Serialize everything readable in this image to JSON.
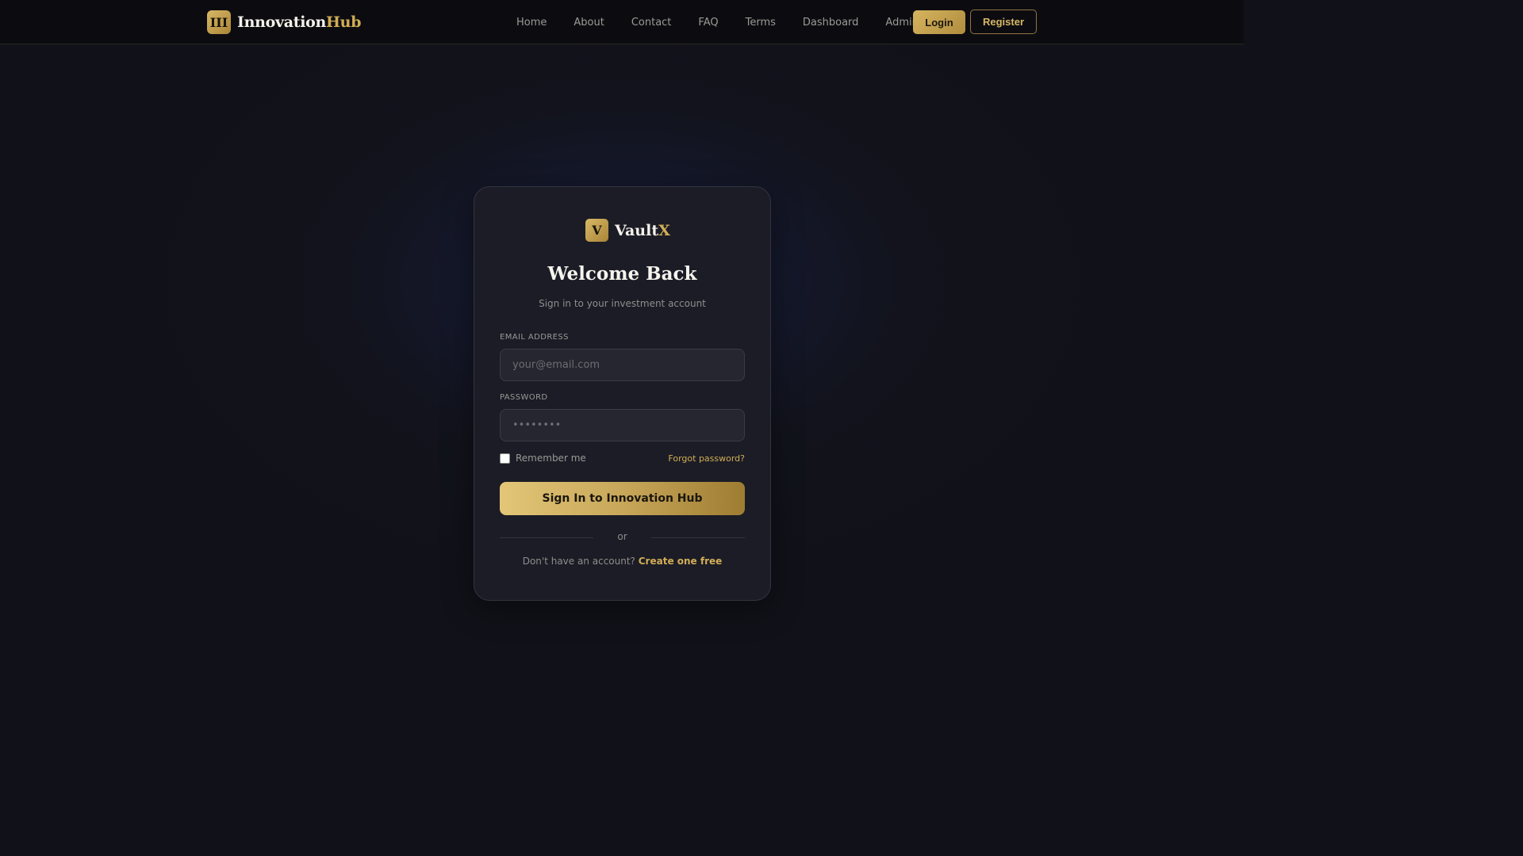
{
  "navbar": {
    "brand_badge": "III",
    "brand_main": "Innovation",
    "brand_accent": "Hub",
    "links": [
      "Home",
      "About",
      "Contact",
      "FAQ",
      "Terms",
      "Dashboard",
      "Admin"
    ],
    "login_label": "Login",
    "register_label": "Register"
  },
  "card": {
    "logo_badge": "V",
    "logo_main": "Vault",
    "logo_accent": "X",
    "title": "Welcome Back",
    "subtitle": "Sign in to your investment account",
    "email_label": "EMAIL ADDRESS",
    "email_placeholder": "your@email.com",
    "email_value": "",
    "password_label": "PASSWORD",
    "password_placeholder": "••••••••",
    "password_value": "",
    "remember_label": "Remember me",
    "remember_checked": false,
    "forgot_label": "Forgot password?",
    "signin_label": "Sign In to Innovation Hub",
    "divider_label": "or",
    "signup_prompt": "Don't have an account?",
    "signup_link": "Create one free"
  },
  "colors": {
    "accent_gold": "#d2ad56",
    "background": "#111219",
    "card_background": "#1b1c26"
  }
}
